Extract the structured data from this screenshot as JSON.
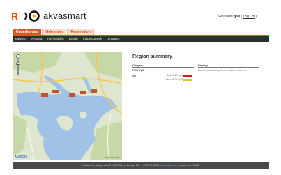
{
  "brand": {
    "r_letter": "R",
    "name": "akvasmart"
  },
  "header": {
    "welcome_prefix": "Welcome ",
    "user": "gull",
    "logoff_prefix": " ( ",
    "logoff_label": "Log Off",
    "logoff_suffix": " )"
  },
  "tabs": [
    {
      "label": "Underfjorden",
      "active": true
    },
    {
      "label": "Gekranger",
      "active": false
    },
    {
      "label": "Festeregion",
      "active": false
    }
  ],
  "subnav": [
    "Kalvøya",
    "Nesøya",
    "Havikodden",
    "Bygdø",
    "Flagesstrands",
    "Snarøya"
  ],
  "map": {
    "provider": "Google",
    "copyright": "©2010 Tele Atlas",
    "colors": {
      "land": "#dfe6cf",
      "forest": "#c6d8a6",
      "water": "#9fc2e6",
      "road": "#f5c94f",
      "marker": "#c0542f"
    }
  },
  "summary": {
    "title": "Region summary",
    "col_oxygen": "Oxygen",
    "col_battery": "Battery",
    "region_name": "Kalvøya",
    "site_name": "M1",
    "red_level": "Red: 4.40 mg/l",
    "blue_level": "Blue: 6.70 mg/l",
    "red_color": "#d01f1f",
    "blue_color": "#e6c31f",
    "battery_note": "No critical battery levels at the moment."
  },
  "footer": {
    "text_before": "Norlab AS | Vangsveien 2 | 1365 Rud | Norway | NF : +47 67174000 | ",
    "email": "contact@norlab.no",
    "text_after": " | Version: 1.5/11"
  }
}
